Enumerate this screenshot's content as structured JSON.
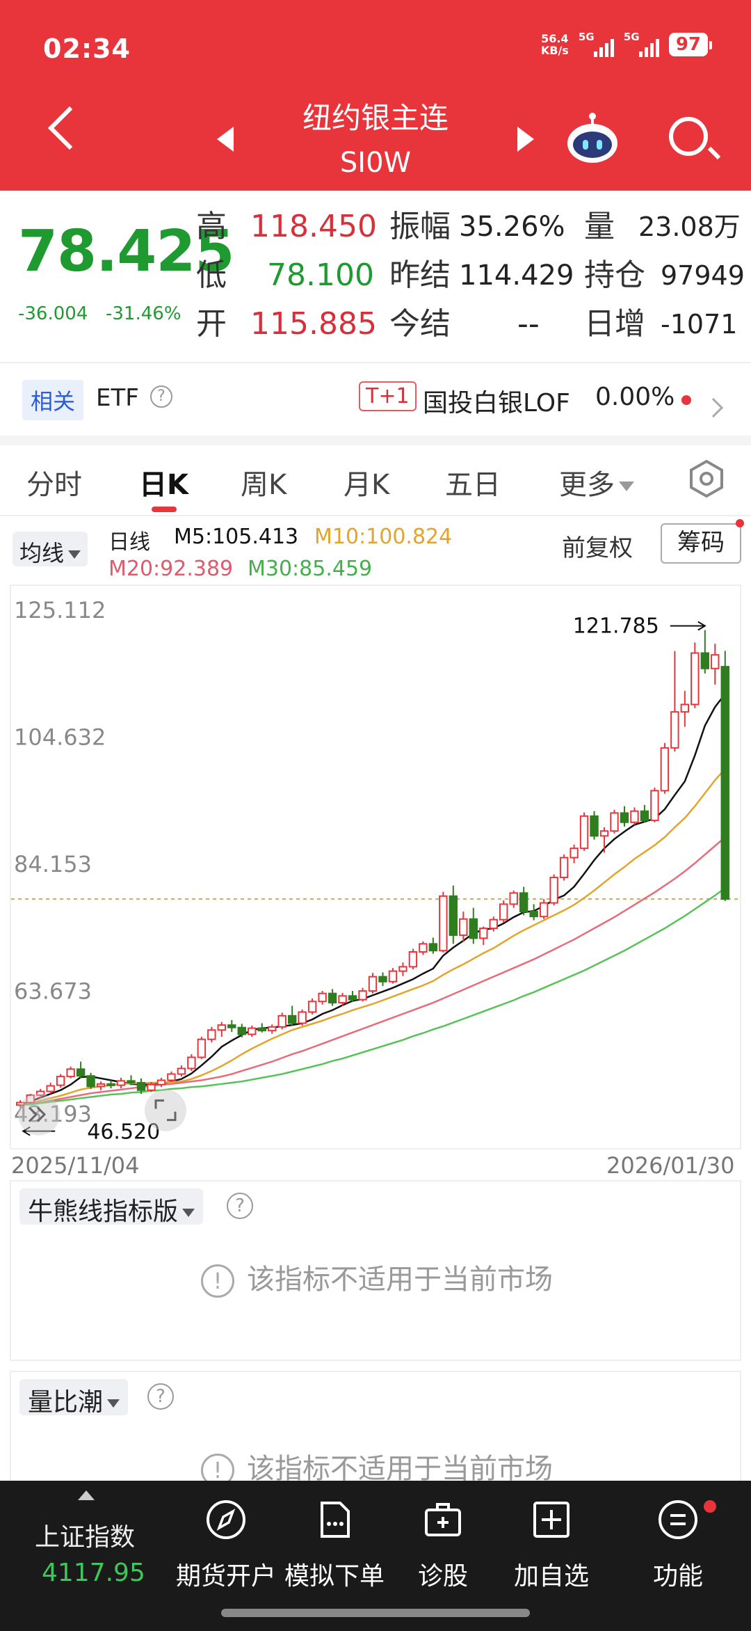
{
  "status_bar": {
    "time": "02:34",
    "net_speed_value": "56.4",
    "net_speed_unit": "KB/s",
    "sim1": "5G",
    "sim2": "5G",
    "battery": "97"
  },
  "header": {
    "title": "纽约银主连",
    "code": "SI0W",
    "icons": [
      "back-icon",
      "prev-icon",
      "next-icon",
      "robot-icon",
      "search-icon"
    ]
  },
  "quote": {
    "last_price": "78.425",
    "change": "-36.004",
    "change_pct": "-31.46%",
    "high_label": "高",
    "high": "118.450",
    "low_label": "低",
    "low": "78.100",
    "open_label": "开",
    "open": "115.885",
    "amplitude_label": "振幅",
    "amplitude": "35.26%",
    "prev_settle_label": "昨结",
    "prev_settle": "114.429",
    "settle_label": "今结",
    "settle": "--",
    "volume_label": "量",
    "volume": "23.08万",
    "open_interest_label": "持仓",
    "open_interest": "97949",
    "daily_change_label": "日增",
    "daily_change": "-1071"
  },
  "etf": {
    "related": "相关",
    "etf_label": "ETF",
    "tplus": "T+1",
    "fund_name": "国投白银LOF",
    "fund_pct": "0.00%"
  },
  "tabs": [
    "分时",
    "日K",
    "周K",
    "月K",
    "五日",
    "更多"
  ],
  "indicators": {
    "ma_select": "均线",
    "period": "日线",
    "m5": "M5:105.413",
    "m10": "M10:100.824",
    "m20": "M20:92.389",
    "m30": "M30:85.459",
    "adjust": "前复权",
    "chip": "筹码"
  },
  "colors": {
    "up": "#e8353b",
    "down": "#2e7d1e",
    "m5": "#111111",
    "m10": "#e3a42a",
    "m20": "#e86b7a",
    "m30": "#57c257"
  },
  "chart_data": {
    "type": "candlestick",
    "y_axis_labels": [
      "125.112",
      "104.632",
      "84.153",
      "63.673",
      "43.193"
    ],
    "ylim": [
      43.193,
      125.112
    ],
    "start_date": "2025/11/04",
    "end_date": "2026/01/30",
    "max_label": "121.785",
    "min_label": "46.520",
    "last_close_line": 78.425,
    "candles": [
      {
        "o": 45.2,
        "h": 46.0,
        "l": 44.8,
        "c": 45.6
      },
      {
        "o": 45.6,
        "h": 47.0,
        "l": 45.4,
        "c": 46.8
      },
      {
        "o": 46.8,
        "h": 47.8,
        "l": 46.3,
        "c": 47.4
      },
      {
        "o": 47.4,
        "h": 48.8,
        "l": 47.0,
        "c": 48.3
      },
      {
        "o": 48.4,
        "h": 50.2,
        "l": 48.0,
        "c": 49.8
      },
      {
        "o": 49.8,
        "h": 51.4,
        "l": 49.5,
        "c": 51.0
      },
      {
        "o": 51.0,
        "h": 52.2,
        "l": 49.6,
        "c": 49.9
      },
      {
        "o": 49.9,
        "h": 50.4,
        "l": 47.8,
        "c": 48.2
      },
      {
        "o": 48.2,
        "h": 49.0,
        "l": 47.6,
        "c": 48.6
      },
      {
        "o": 48.6,
        "h": 49.2,
        "l": 47.9,
        "c": 48.4
      },
      {
        "o": 48.4,
        "h": 49.6,
        "l": 47.9,
        "c": 49.1
      },
      {
        "o": 49.1,
        "h": 50.0,
        "l": 48.4,
        "c": 48.8
      },
      {
        "o": 48.8,
        "h": 49.5,
        "l": 47.0,
        "c": 47.6
      },
      {
        "o": 47.6,
        "h": 48.9,
        "l": 47.3,
        "c": 48.5
      },
      {
        "o": 48.5,
        "h": 49.6,
        "l": 48.1,
        "c": 49.2
      },
      {
        "o": 49.2,
        "h": 50.6,
        "l": 48.9,
        "c": 50.2
      },
      {
        "o": 50.2,
        "h": 51.6,
        "l": 49.8,
        "c": 51.1
      },
      {
        "o": 51.1,
        "h": 53.4,
        "l": 50.7,
        "c": 52.9
      },
      {
        "o": 52.9,
        "h": 56.2,
        "l": 52.6,
        "c": 55.8
      },
      {
        "o": 55.8,
        "h": 57.8,
        "l": 55.3,
        "c": 57.3
      },
      {
        "o": 57.3,
        "h": 58.6,
        "l": 56.2,
        "c": 58.1
      },
      {
        "o": 58.1,
        "h": 58.9,
        "l": 57.0,
        "c": 57.7
      },
      {
        "o": 57.7,
        "h": 58.3,
        "l": 56.1,
        "c": 56.6
      },
      {
        "o": 56.6,
        "h": 58.0,
        "l": 56.2,
        "c": 57.6
      },
      {
        "o": 57.6,
        "h": 58.4,
        "l": 56.9,
        "c": 57.2
      },
      {
        "o": 57.2,
        "h": 58.2,
        "l": 56.7,
        "c": 57.8
      },
      {
        "o": 57.8,
        "h": 60.1,
        "l": 57.4,
        "c": 59.6
      },
      {
        "o": 59.6,
        "h": 61.2,
        "l": 58.0,
        "c": 58.4
      },
      {
        "o": 58.4,
        "h": 60.6,
        "l": 58.0,
        "c": 60.2
      },
      {
        "o": 60.2,
        "h": 62.4,
        "l": 59.8,
        "c": 61.9
      },
      {
        "o": 61.9,
        "h": 63.6,
        "l": 61.4,
        "c": 63.2
      },
      {
        "o": 63.2,
        "h": 63.9,
        "l": 61.2,
        "c": 61.7
      },
      {
        "o": 61.7,
        "h": 63.3,
        "l": 61.2,
        "c": 62.8
      },
      {
        "o": 62.8,
        "h": 63.6,
        "l": 61.8,
        "c": 62.2
      },
      {
        "o": 62.2,
        "h": 64.1,
        "l": 61.9,
        "c": 63.6
      },
      {
        "o": 63.6,
        "h": 66.5,
        "l": 63.2,
        "c": 65.9
      },
      {
        "o": 65.9,
        "h": 66.6,
        "l": 64.4,
        "c": 65.1
      },
      {
        "o": 65.1,
        "h": 67.3,
        "l": 64.8,
        "c": 66.8
      },
      {
        "o": 66.8,
        "h": 68.2,
        "l": 66.0,
        "c": 67.5
      },
      {
        "o": 67.5,
        "h": 70.4,
        "l": 67.1,
        "c": 69.9
      },
      {
        "o": 69.9,
        "h": 71.6,
        "l": 69.4,
        "c": 71.2
      },
      {
        "o": 71.2,
        "h": 72.2,
        "l": 69.6,
        "c": 70.1
      },
      {
        "o": 70.1,
        "h": 79.6,
        "l": 69.8,
        "c": 78.9
      },
      {
        "o": 78.9,
        "h": 80.6,
        "l": 71.2,
        "c": 72.6
      },
      {
        "o": 72.6,
        "h": 76.4,
        "l": 71.5,
        "c": 75.2
      },
      {
        "o": 75.2,
        "h": 77.0,
        "l": 71.2,
        "c": 72.1
      },
      {
        "o": 72.1,
        "h": 74.0,
        "l": 71.0,
        "c": 73.7
      },
      {
        "o": 73.7,
        "h": 75.6,
        "l": 73.2,
        "c": 75.1
      },
      {
        "o": 75.1,
        "h": 78.2,
        "l": 74.6,
        "c": 77.6
      },
      {
        "o": 77.6,
        "h": 79.8,
        "l": 77.0,
        "c": 79.4
      },
      {
        "o": 79.4,
        "h": 80.4,
        "l": 75.8,
        "c": 76.4
      },
      {
        "o": 76.4,
        "h": 77.6,
        "l": 75.0,
        "c": 75.6
      },
      {
        "o": 75.6,
        "h": 78.4,
        "l": 75.2,
        "c": 77.8
      },
      {
        "o": 77.8,
        "h": 82.4,
        "l": 77.4,
        "c": 81.9
      },
      {
        "o": 81.9,
        "h": 85.6,
        "l": 81.4,
        "c": 85.1
      },
      {
        "o": 85.1,
        "h": 87.2,
        "l": 84.2,
        "c": 86.6
      },
      {
        "o": 86.6,
        "h": 92.4,
        "l": 86.2,
        "c": 91.8
      },
      {
        "o": 91.8,
        "h": 92.6,
        "l": 88.0,
        "c": 88.6
      },
      {
        "o": 88.6,
        "h": 90.0,
        "l": 85.9,
        "c": 89.4
      },
      {
        "o": 89.4,
        "h": 92.8,
        "l": 89.0,
        "c": 92.3
      },
      {
        "o": 92.3,
        "h": 93.4,
        "l": 90.1,
        "c": 90.8
      },
      {
        "o": 90.8,
        "h": 93.2,
        "l": 90.4,
        "c": 92.6
      },
      {
        "o": 92.6,
        "h": 93.6,
        "l": 90.8,
        "c": 91.1
      },
      {
        "o": 91.1,
        "h": 96.4,
        "l": 90.8,
        "c": 95.9
      },
      {
        "o": 95.9,
        "h": 103.6,
        "l": 95.4,
        "c": 102.8
      },
      {
        "o": 102.8,
        "h": 118.4,
        "l": 102.2,
        "c": 108.6
      },
      {
        "o": 108.6,
        "h": 112.0,
        "l": 106.2,
        "c": 109.8
      },
      {
        "o": 109.8,
        "h": 119.8,
        "l": 109.2,
        "c": 118.1
      },
      {
        "o": 118.1,
        "h": 121.8,
        "l": 114.8,
        "c": 115.6
      },
      {
        "o": 115.6,
        "h": 119.6,
        "l": 113.0,
        "c": 117.8
      },
      {
        "o": 115.9,
        "h": 118.45,
        "l": 78.1,
        "c": 78.425
      }
    ],
    "moving_averages": [
      {
        "name": "M5",
        "values": [
          45.2,
          45.8,
          46.4,
          47.0,
          47.6,
          48.5,
          49.7,
          49.8,
          49.5,
          49.2,
          48.9,
          48.6,
          48.5,
          48.5,
          48.6,
          49.0,
          49.4,
          50.3,
          51.6,
          53.0,
          54.6,
          55.6,
          56.5,
          57.3,
          57.6,
          57.7,
          57.9,
          58.1,
          58.4,
          59.0,
          59.9,
          60.5,
          61.3,
          62.0,
          62.3,
          62.9,
          63.5,
          64.1,
          64.8,
          65.5,
          66.4,
          67.2,
          69.3,
          70.6,
          71.7,
          72.9,
          73.5,
          73.7,
          74.5,
          75.5,
          76.3,
          76.5,
          77.3,
          78.3,
          79.0,
          80.4,
          82.5,
          84.7,
          86.6,
          88.1,
          89.3,
          90.4,
          90.9,
          91.4,
          92.9,
          95.2,
          97.4,
          101.6,
          106.4,
          109.4,
          111.5
        ]
      },
      {
        "name": "M10",
        "values": [
          45.2,
          45.5,
          45.9,
          46.3,
          46.7,
          47.2,
          47.7,
          48.0,
          48.2,
          48.4,
          48.6,
          48.7,
          48.7,
          48.8,
          48.8,
          48.9,
          49.0,
          49.4,
          50.0,
          50.7,
          51.5,
          52.4,
          53.4,
          54.3,
          55.1,
          55.9,
          56.6,
          57.3,
          57.8,
          58.3,
          58.8,
          59.4,
          59.9,
          60.5,
          61.0,
          61.5,
          62.1,
          62.7,
          63.3,
          63.9,
          64.5,
          65.2,
          66.2,
          67.1,
          67.9,
          68.8,
          69.7,
          70.5,
          71.5,
          72.5,
          73.4,
          74.2,
          75.0,
          75.8,
          76.6,
          77.5,
          78.6,
          79.8,
          81.1,
          82.4,
          83.6,
          84.9,
          86.0,
          87.1,
          88.4,
          90.0,
          91.5,
          93.4,
          95.5,
          97.6,
          99.4
        ]
      },
      {
        "name": "M20",
        "values": [
          45.2,
          45.4,
          45.6,
          45.9,
          46.2,
          46.5,
          46.8,
          47.1,
          47.3,
          47.5,
          47.7,
          47.9,
          48.1,
          48.3,
          48.5,
          48.6,
          48.8,
          49.0,
          49.2,
          49.5,
          49.8,
          50.2,
          50.7,
          51.2,
          51.7,
          52.2,
          52.8,
          53.4,
          53.9,
          54.5,
          55.1,
          55.7,
          56.3,
          56.9,
          57.5,
          58.1,
          58.7,
          59.3,
          59.9,
          60.5,
          61.1,
          61.7,
          62.4,
          63.1,
          63.8,
          64.5,
          65.2,
          65.9,
          66.6,
          67.3,
          68.0,
          68.7,
          69.5,
          70.3,
          71.1,
          71.9,
          72.8,
          73.7,
          74.6,
          75.5,
          76.5,
          77.5,
          78.5,
          79.5,
          80.6,
          81.7,
          82.9,
          84.2,
          85.6,
          87.0,
          88.4
        ]
      },
      {
        "name": "M30",
        "values": [
          45.2,
          45.3,
          45.5,
          45.7,
          45.9,
          46.1,
          46.3,
          46.5,
          46.7,
          46.9,
          47.0,
          47.2,
          47.3,
          47.5,
          47.6,
          47.8,
          47.9,
          48.1,
          48.2,
          48.4,
          48.6,
          48.8,
          49.0,
          49.3,
          49.6,
          49.9,
          50.2,
          50.6,
          51.0,
          51.4,
          51.8,
          52.3,
          52.7,
          53.2,
          53.7,
          54.2,
          54.7,
          55.2,
          55.7,
          56.3,
          56.8,
          57.4,
          57.9,
          58.5,
          59.1,
          59.7,
          60.3,
          60.9,
          61.5,
          62.1,
          62.8,
          63.4,
          64.1,
          64.8,
          65.5,
          66.2,
          66.9,
          67.7,
          68.5,
          69.3,
          70.1,
          71.0,
          71.9,
          72.8,
          73.7,
          74.7,
          75.7,
          76.8,
          77.9,
          79.0,
          80.2
        ]
      }
    ]
  },
  "panels": {
    "panel1_title": "牛熊线指标版",
    "panel2_title": "量比潮",
    "notice": "该指标不适用于当前市场",
    "notice_mark": "!",
    "help_mark": "?"
  },
  "bottom_bar": {
    "index_name": "上证指数",
    "index_value": "4117.95",
    "items": [
      {
        "label": "期货开户",
        "icon": "compass-icon"
      },
      {
        "label": "模拟下单",
        "icon": "document-icon"
      },
      {
        "label": "诊股",
        "icon": "medical-kit-icon"
      },
      {
        "label": "加自选",
        "icon": "add-square-icon"
      },
      {
        "label": "功能",
        "icon": "menu-circle-icon"
      }
    ]
  }
}
